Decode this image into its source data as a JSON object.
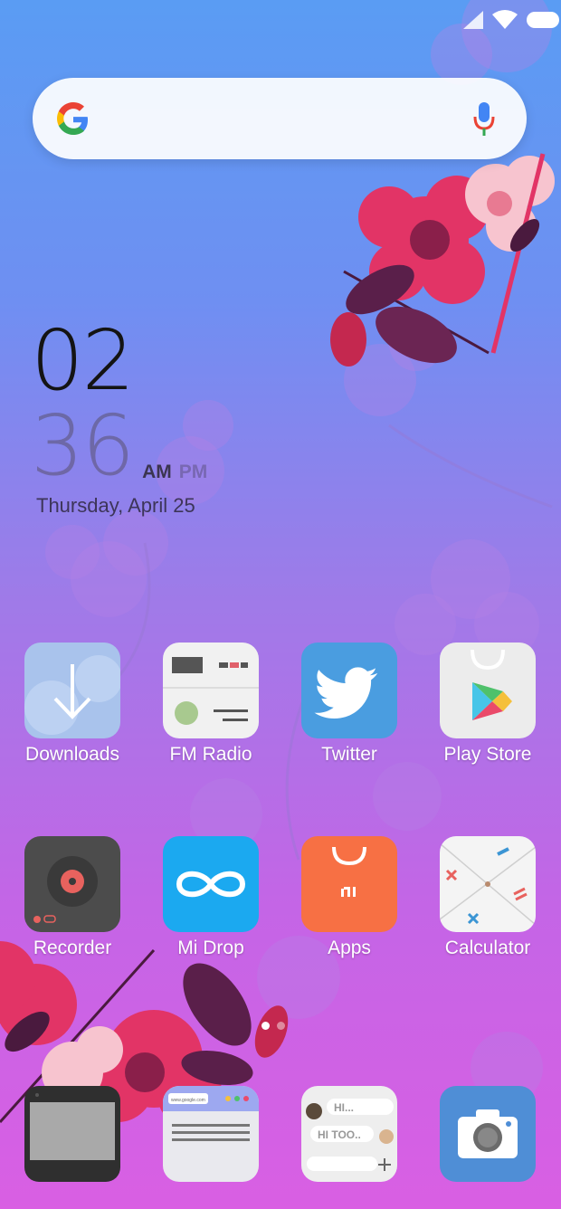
{
  "status_bar": {
    "signal_icon": "signal-icon",
    "wifi_icon": "wifi-icon",
    "battery_icon": "battery-icon"
  },
  "search": {
    "logo": "google-logo",
    "mic_icon": "mic-icon"
  },
  "clock": {
    "hour": "02",
    "minute": "36",
    "am": "AM",
    "pm": "PM",
    "date": "Thursday, April 25"
  },
  "apps": [
    {
      "label": "Downloads",
      "icon": "downloads-icon"
    },
    {
      "label": "FM Radio",
      "icon": "fm-radio-icon"
    },
    {
      "label": "Twitter",
      "icon": "twitter-icon"
    },
    {
      "label": "Play Store",
      "icon": "play-store-icon"
    },
    {
      "label": "Recorder",
      "icon": "recorder-icon"
    },
    {
      "label": "Mi Drop",
      "icon": "mi-drop-icon"
    },
    {
      "label": "Apps",
      "icon": "mi-apps-icon"
    },
    {
      "label": "Calculator",
      "icon": "calculator-icon"
    }
  ],
  "dock": [
    {
      "icon": "phone-icon"
    },
    {
      "icon": "browser-icon"
    },
    {
      "icon": "messages-icon"
    },
    {
      "icon": "camera-icon"
    }
  ],
  "dock_text": {
    "browser_url": "www.google.com",
    "msg_hi": "HI...",
    "msg_hi_too": "HI TOO.."
  },
  "page_indicator": {
    "pages": 2,
    "current": 1
  },
  "colors": {
    "gradient_top": "#5a9cf3",
    "gradient_bottom": "#d95fe3",
    "flower_red": "#e23466",
    "leaf_dark": "#5a1f4a"
  }
}
